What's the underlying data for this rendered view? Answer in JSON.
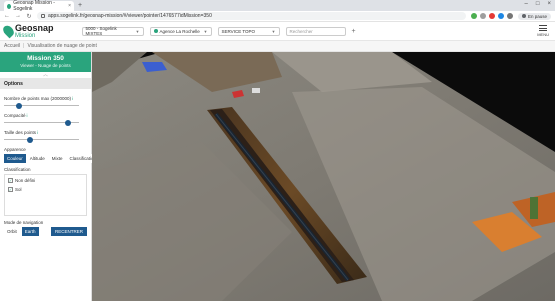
{
  "browser": {
    "tab_title": "Geosnap Mission - Sogelink",
    "tab_close": "×",
    "new_tab": "+",
    "url": "apps.sogelink.fr/geosnap-mission/#/viewer/pointer/1476577idMission=350",
    "back": "←",
    "forward": "→",
    "reload": "↻",
    "profile": "En pause",
    "minimize": "–",
    "maximize": "□",
    "close": "×"
  },
  "app": {
    "logo_line1": "Geosnap",
    "logo_line2": "Mission",
    "company_select": "5000 - Sogelink MIXTES",
    "agency_select": "Agence La Rochelle",
    "service_select": "SERVICE TOPO",
    "search_placeholder": "Rechercher",
    "add_label": "+",
    "menu_label": "MENU"
  },
  "breadcrumb": {
    "items": [
      "Accueil",
      "Visualisation de nuage de point"
    ],
    "separator": "|"
  },
  "panel": {
    "title": "Mission 350",
    "subtitle": "Viewer - Nuage de points",
    "options_header": "Options",
    "point_count_label": "Nombre de points max (2000000)",
    "compacity_label": "Compacité",
    "point_size_label": "Taille des points",
    "required_mark": "i",
    "appearance_label": "Apparence",
    "appearance_options": [
      "Couleur",
      "Altitude",
      "Mixte",
      "Classification"
    ],
    "appearance_selected": "Couleur",
    "classification_label": "Classification",
    "classes": [
      {
        "label": "Non défini",
        "checked": true
      },
      {
        "label": "Sol",
        "checked": true
      }
    ],
    "navigation_label": "Mode de navigation",
    "navigation_options": [
      "Orbit",
      "Earth"
    ],
    "navigation_selected": "Earth",
    "recenter_label": "RECENTRER"
  },
  "sliders": {
    "point_count": 0.2,
    "compacity": 0.85,
    "point_size": 0.35
  },
  "colors": {
    "brand": "#2aa47d",
    "primary_button": "#1f5a8e"
  }
}
